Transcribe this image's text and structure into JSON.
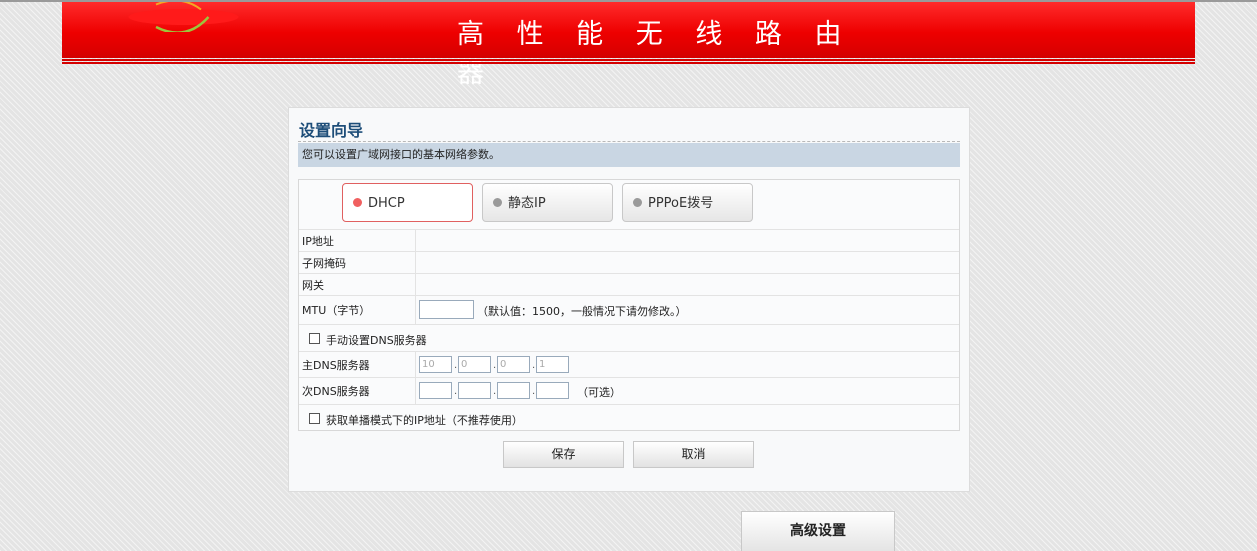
{
  "header": {
    "title": "高 性 能 无 线 路 由 器"
  },
  "wizard": {
    "title": "设置向导",
    "description": "您可以设置广域网接口的基本网络参数。",
    "tabs": [
      {
        "label": "DHCP",
        "active": true
      },
      {
        "label": "静态IP",
        "active": false
      },
      {
        "label": "PPPoE拨号",
        "active": false
      }
    ],
    "fields": {
      "ip_label": "IP地址",
      "mask_label": "子网掩码",
      "gateway_label": "网关",
      "mtu_label": "MTU（字节）",
      "mtu_value": "",
      "mtu_hint": "（默认值：1500，一般情况下请勿修改。）"
    },
    "dns": {
      "manual_label": "手动设置DNS服务器",
      "manual_checked": false,
      "primary_label": "主DNS服务器",
      "primary_octets": [
        "10",
        "0",
        "0",
        "1"
      ],
      "secondary_label": "次DNS服务器",
      "secondary_octets": [
        "",
        "",
        "",
        ""
      ],
      "secondary_hint": "（可选）"
    },
    "unicast": {
      "label": "获取单播模式下的IP地址（不推荐使用）",
      "checked": false
    },
    "buttons": {
      "save": "保存",
      "cancel": "取消"
    }
  },
  "advanced_button": "高级设置",
  "colors": {
    "banner_red": "#ee0000",
    "title_blue": "#1e4e79",
    "desc_bar": "#c9d6e3",
    "active_dot": "#f06060"
  }
}
